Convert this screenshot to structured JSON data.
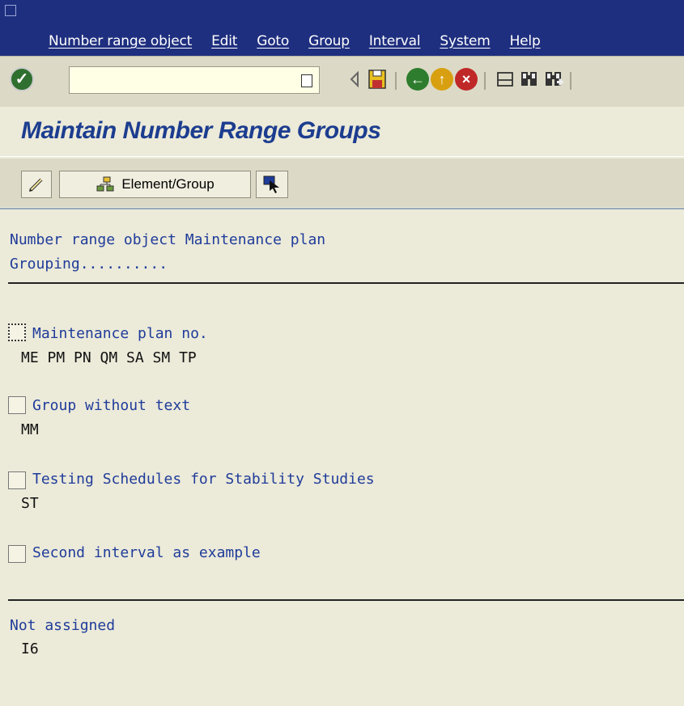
{
  "menu": {
    "items": [
      "Number range object",
      "Edit",
      "Goto",
      "Group",
      "Interval",
      "System",
      "Help"
    ]
  },
  "toolbar": {
    "command_value": "",
    "icons": [
      "enter-icon",
      "command-history-icon",
      "back-arrow-icon",
      "save-icon",
      "back-icon",
      "exit-icon",
      "cancel-icon",
      "print-icon",
      "find-icon",
      "find-next-icon"
    ]
  },
  "page": {
    "title": "Maintain Number Range Groups"
  },
  "app_toolbar": {
    "edit_icon": "pencil-icon",
    "element_group_label": "Element/Group",
    "select_icon": "cursor-select-icon"
  },
  "header": {
    "object_line": "Number range object Maintenance plan",
    "grouping_line": "Grouping.........."
  },
  "groups": [
    {
      "name": "Maintenance plan no.",
      "elements": "ME PM PN QM SA SM TP",
      "checked": false
    },
    {
      "name": "Group without text",
      "elements": "MM",
      "checked": false
    },
    {
      "name": "Testing Schedules for Stability Studies",
      "elements": "ST",
      "checked": false
    },
    {
      "name": "Second interval as example",
      "elements": "",
      "checked": false
    }
  ],
  "not_assigned": {
    "label": "Not assigned",
    "elements": "I6"
  },
  "colors": {
    "menubar": "#1f2f7f",
    "title": "#1c3d8f",
    "background": "#ecead9",
    "text_blue": "#1f3c9a"
  }
}
